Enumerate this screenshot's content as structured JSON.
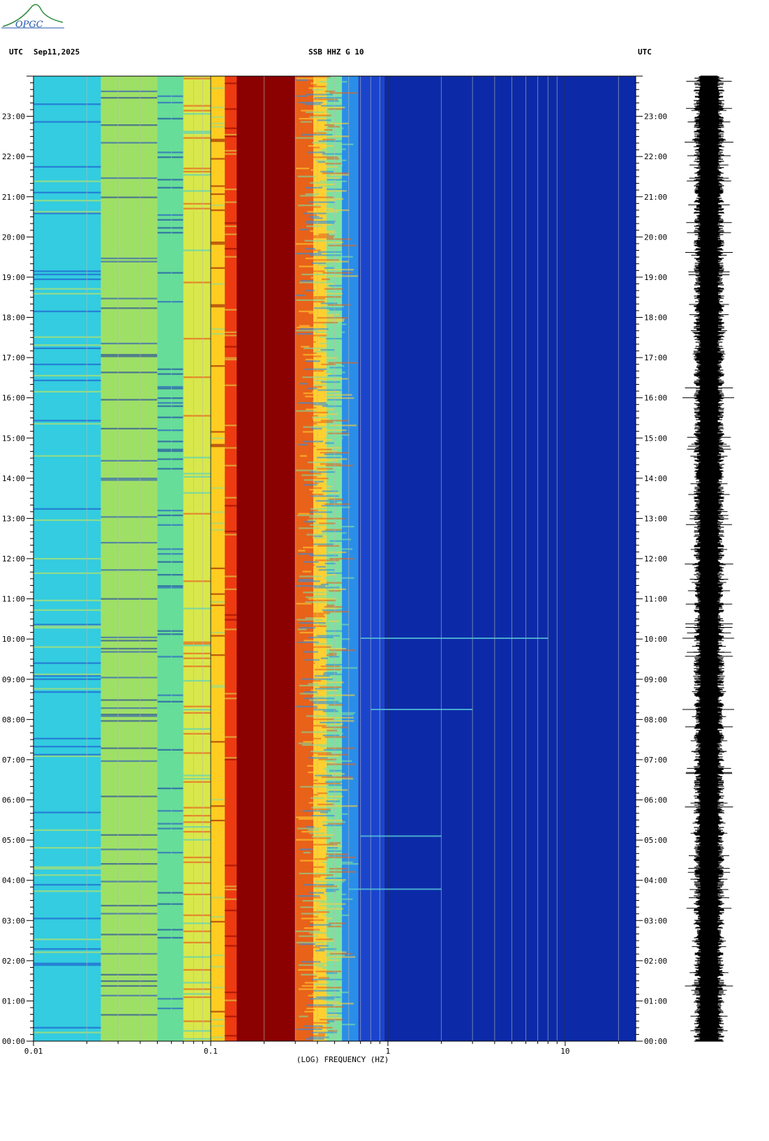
{
  "header": {
    "left_timezone": "UTC",
    "date": "Sep11,2025",
    "station": "SSB HHZ G 10",
    "right_timezone": "UTC"
  },
  "logo": {
    "text": "OPGC",
    "icon": "opgc-logo-icon",
    "color": "#2a8a3a"
  },
  "chart_data": {
    "type": "heatmap",
    "title": "SSB HHZ G 10",
    "xlabel": "(LOG) FREQUENCY (HZ)",
    "x_scale": "log",
    "xlim": [
      0.01,
      25
    ],
    "x_ticks": [
      0.01,
      0.1,
      1,
      10
    ],
    "x_tick_labels": [
      "0.01",
      "0.1",
      "1",
      "10"
    ],
    "ylim_hours": [
      0,
      24
    ],
    "y_ticks": [
      "00:00",
      "01:00",
      "02:00",
      "03:00",
      "04:00",
      "05:00",
      "06:00",
      "07:00",
      "08:00",
      "09:00",
      "10:00",
      "11:00",
      "12:00",
      "13:00",
      "14:00",
      "15:00",
      "16:00",
      "17:00",
      "18:00",
      "19:00",
      "20:00",
      "21:00",
      "22:00",
      "23:00"
    ],
    "frequency_bands": [
      {
        "f_from": 0.01,
        "f_to": 0.024,
        "color": "#33cce0"
      },
      {
        "f_from": 0.024,
        "f_to": 0.05,
        "color": "#9ee066"
      },
      {
        "f_from": 0.05,
        "f_to": 0.07,
        "color": "#66dd99"
      },
      {
        "f_from": 0.07,
        "f_to": 0.1,
        "color": "#d8e84a"
      },
      {
        "f_from": 0.1,
        "f_to": 0.12,
        "color": "#ffcc22"
      },
      {
        "f_from": 0.12,
        "f_to": 0.14,
        "color": "#ee3a10"
      },
      {
        "f_from": 0.14,
        "f_to": 0.3,
        "color": "#8b0000"
      },
      {
        "f_from": 0.3,
        "f_to": 0.38,
        "color": "#e8621a"
      },
      {
        "f_from": 0.38,
        "f_to": 0.45,
        "color": "#ffd030"
      },
      {
        "f_from": 0.45,
        "f_to": 0.55,
        "color": "#7ee0a0"
      },
      {
        "f_from": 0.55,
        "f_to": 0.68,
        "color": "#2a8ee8"
      },
      {
        "f_from": 0.68,
        "f_to": 0.95,
        "color": "#1a44cc"
      },
      {
        "f_from": 0.95,
        "f_to": 25,
        "color": "#0c2aa8"
      }
    ],
    "events_utc_hours": [
      {
        "time": 10.02,
        "f_from": 0.7,
        "f_to": 8.0
      },
      {
        "time": 8.25,
        "f_from": 0.8,
        "f_to": 3.0
      },
      {
        "time": 5.1,
        "f_from": 0.7,
        "f_to": 2.0
      },
      {
        "time": 3.78,
        "f_from": 0.6,
        "f_to": 2.0
      }
    ],
    "colormap": [
      "#0c2aa8",
      "#1a44cc",
      "#2a8ee8",
      "#33cce0",
      "#7ee0a0",
      "#d8e84a",
      "#ffcc22",
      "#ee3a10",
      "#8b0000"
    ]
  }
}
